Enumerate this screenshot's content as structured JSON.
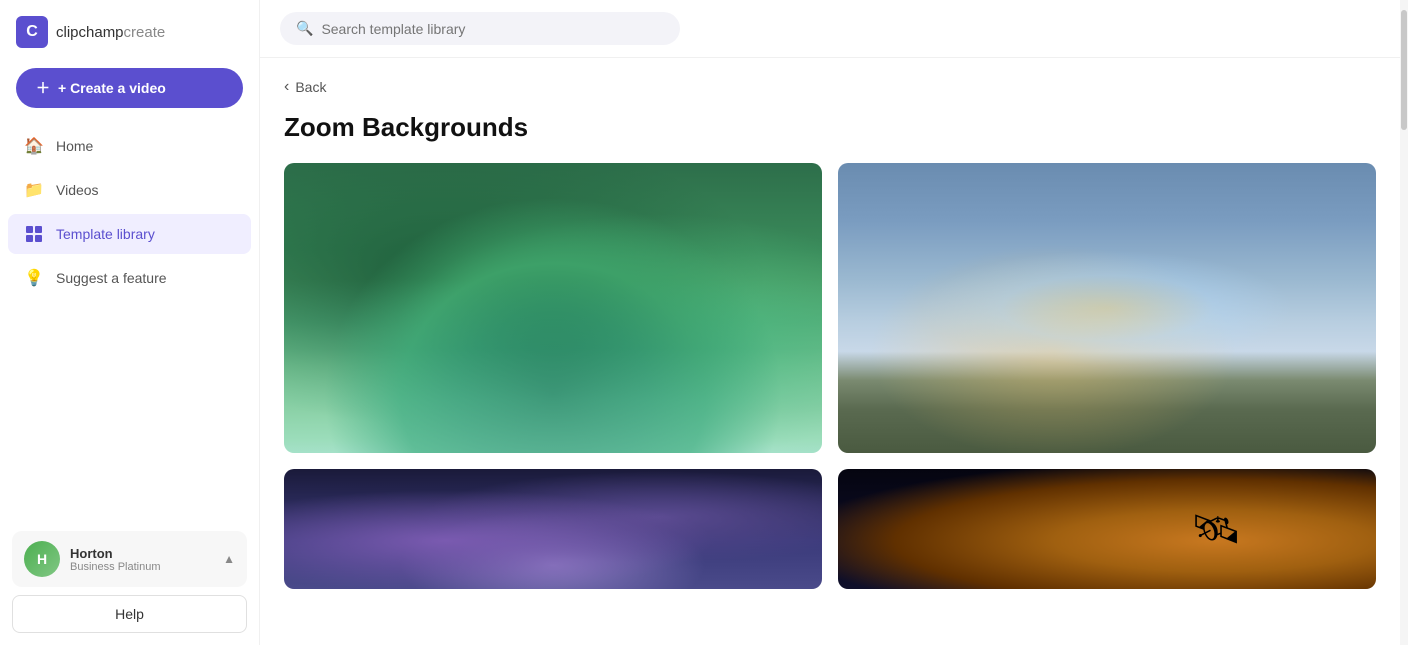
{
  "app": {
    "logo_letter": "C",
    "logo_name": "clipchamp",
    "logo_suffix": "create"
  },
  "sidebar": {
    "create_button": "+ Create a video",
    "nav_items": [
      {
        "id": "home",
        "label": "Home",
        "icon": "🏠",
        "active": false
      },
      {
        "id": "videos",
        "label": "Videos",
        "icon": "📁",
        "active": false
      },
      {
        "id": "template-library",
        "label": "Template library",
        "icon": "⬛",
        "active": true
      },
      {
        "id": "suggest-feature",
        "label": "Suggest a feature",
        "icon": "💡",
        "active": false
      }
    ],
    "user": {
      "name": "Horton",
      "plan": "Business Platinum",
      "initials": "H"
    },
    "help_button": "Help"
  },
  "topbar": {
    "search_placeholder": "Search template library"
  },
  "content": {
    "back_label": "Back",
    "page_title": "Zoom Backgrounds",
    "templates": [
      {
        "id": "waterfall",
        "alt": "Waterfall scene"
      },
      {
        "id": "rainbow",
        "alt": "Rainbow over ocean"
      },
      {
        "id": "coral",
        "alt": "Underwater coral"
      },
      {
        "id": "satellite",
        "alt": "Satellite in space"
      }
    ]
  }
}
